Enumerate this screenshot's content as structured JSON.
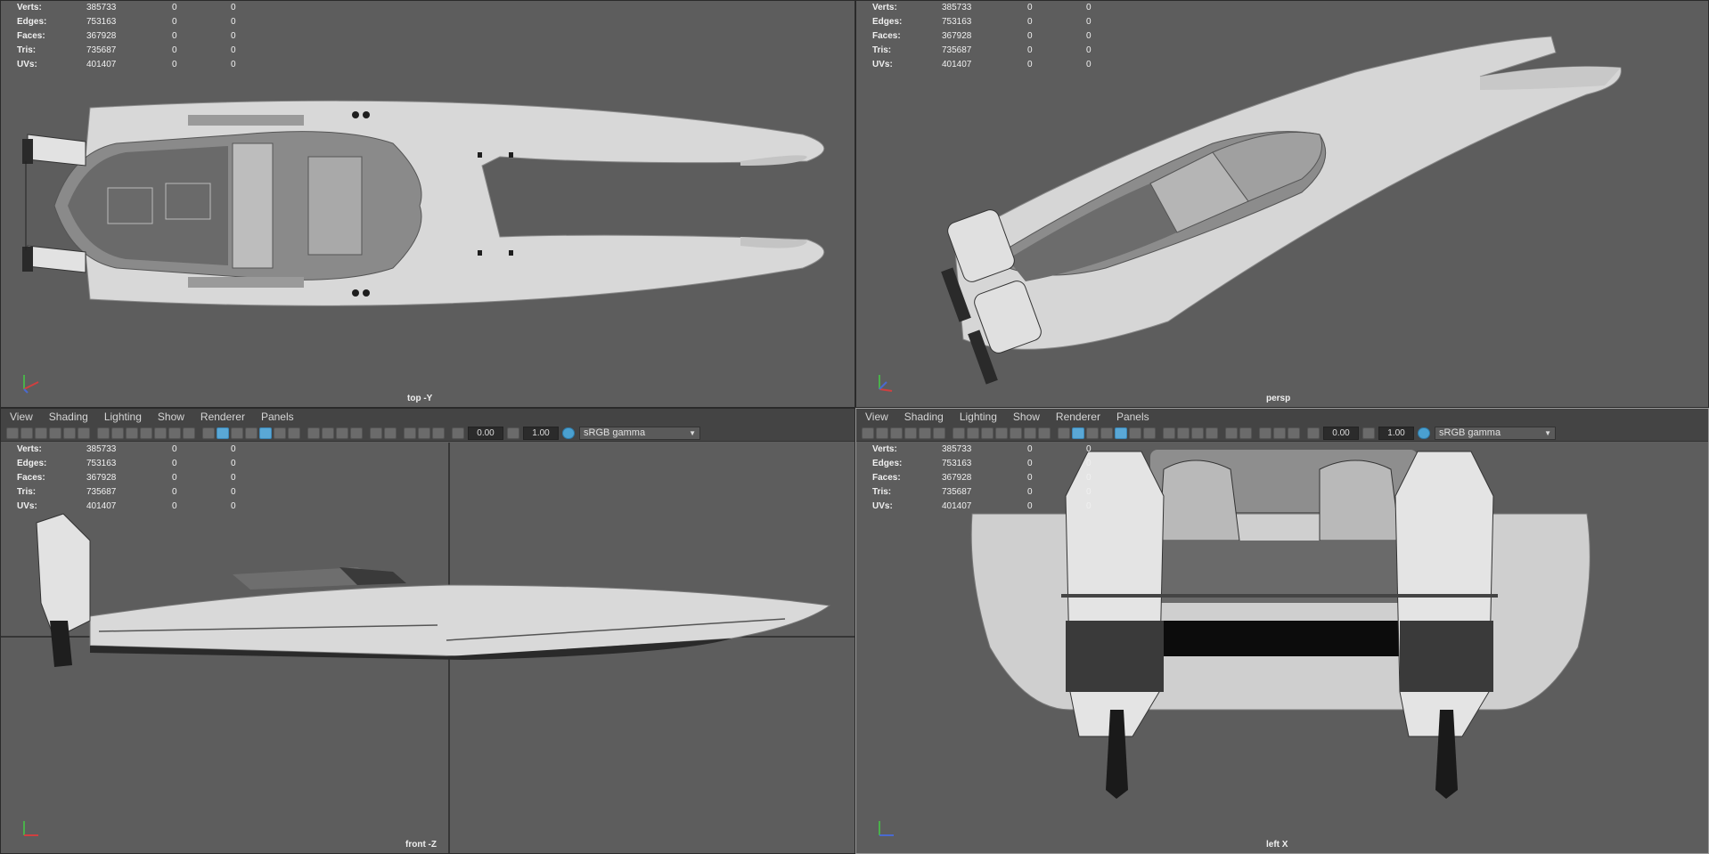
{
  "stats": {
    "rows": [
      {
        "label": "Verts:",
        "value": "385733",
        "sel": "0",
        "comp": "0"
      },
      {
        "label": "Edges:",
        "value": "753163",
        "sel": "0",
        "comp": "0"
      },
      {
        "label": "Faces:",
        "value": "367928",
        "sel": "0",
        "comp": "0"
      },
      {
        "label": "Tris:",
        "value": "735687",
        "sel": "0",
        "comp": "0"
      },
      {
        "label": "UVs:",
        "value": "401407",
        "sel": "0",
        "comp": "0"
      }
    ]
  },
  "menu": {
    "view": "View",
    "shading": "Shading",
    "lighting": "Lighting",
    "show": "Show",
    "renderer": "Renderer",
    "panels": "Panels"
  },
  "toolbar": {
    "exposure": "0.00",
    "gamma": "1.00",
    "colorspace": "sRGB gamma"
  },
  "panes": {
    "top_left": {
      "camera": "top -Y"
    },
    "top_right": {
      "camera": "persp"
    },
    "bottom_left": {
      "camera": "front -Z"
    },
    "bottom_right": {
      "camera": "left X"
    }
  },
  "colors": {
    "viewport_bg": "#5d5d5d",
    "menubar_bg": "#444444",
    "accent": "#5aa8d6",
    "hull": "#d9d9d9"
  }
}
